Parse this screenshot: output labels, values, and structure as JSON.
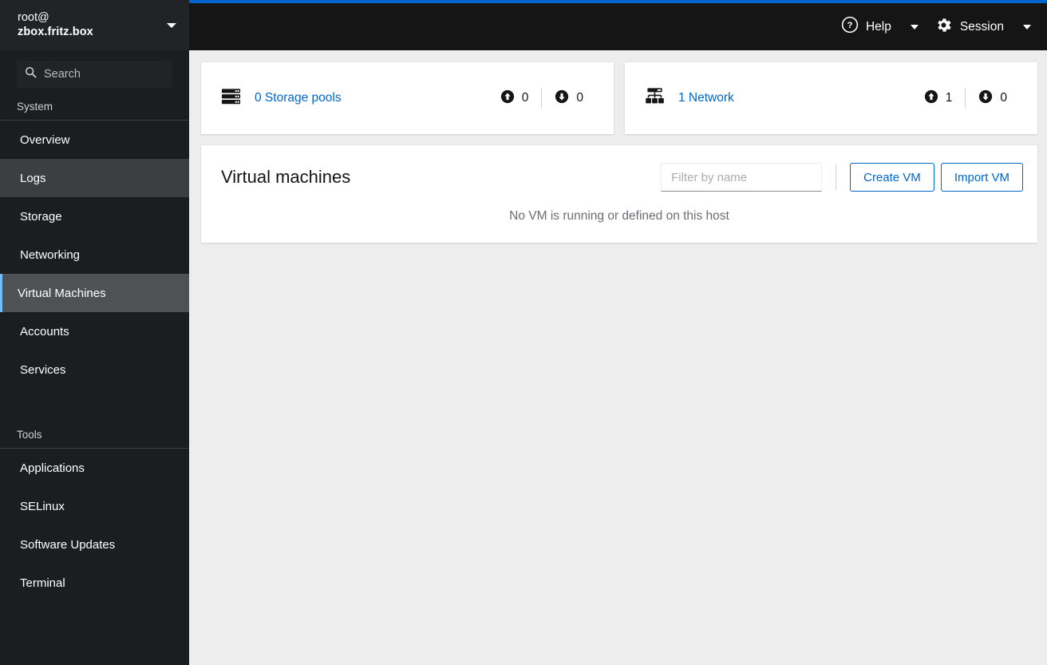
{
  "sidebar": {
    "host": {
      "user": "root@",
      "machine": "zbox.fritz.box",
      "caret_icon": "chevron-down-icon"
    },
    "search": {
      "placeholder": "Search",
      "icon": "search-icon"
    },
    "sections": [
      {
        "title": "System",
        "items": [
          {
            "label": "Overview",
            "state": "default"
          },
          {
            "label": "Logs",
            "state": "hovered"
          },
          {
            "label": "Storage",
            "state": "default"
          },
          {
            "label": "Networking",
            "state": "default"
          },
          {
            "label": "Virtual Machines",
            "state": "active"
          },
          {
            "label": "Accounts",
            "state": "default"
          },
          {
            "label": "Services",
            "state": "default"
          }
        ]
      },
      {
        "title": "Tools",
        "items": [
          {
            "label": "Applications",
            "state": "default"
          },
          {
            "label": "SELinux",
            "state": "default"
          },
          {
            "label": "Software Updates",
            "state": "default"
          },
          {
            "label": "Terminal",
            "state": "default"
          }
        ]
      }
    ]
  },
  "topbar": {
    "help": {
      "label": "Help",
      "icon": "help-circle-icon",
      "caret_icon": "caret-down-icon"
    },
    "session": {
      "label": "Session",
      "icon": "gear-icon",
      "caret_icon": "caret-down-icon"
    }
  },
  "summary_cards": [
    {
      "icon": "storage-pool-icon",
      "link_label": "0 Storage pools",
      "up_icon": "arrow-up-circle-icon",
      "up_count": "0",
      "down_icon": "arrow-down-circle-icon",
      "down_count": "0"
    },
    {
      "icon": "network-topology-icon",
      "link_label": "1 Network",
      "up_icon": "arrow-up-circle-icon",
      "up_count": "1",
      "down_icon": "arrow-down-circle-icon",
      "down_count": "0"
    }
  ],
  "vm_panel": {
    "title": "Virtual machines",
    "filter_placeholder": "Filter by name",
    "filter_value": "",
    "create_label": "Create VM",
    "import_label": "Import VM",
    "empty_message": "No VM is running or defined on this host"
  },
  "colors": {
    "accent_blue": "#0066cc",
    "active_marker": "#73bcf7",
    "sidebar_bg": "#1b1d21",
    "topbar_bg": "#151515",
    "page_bg": "#ededed"
  }
}
